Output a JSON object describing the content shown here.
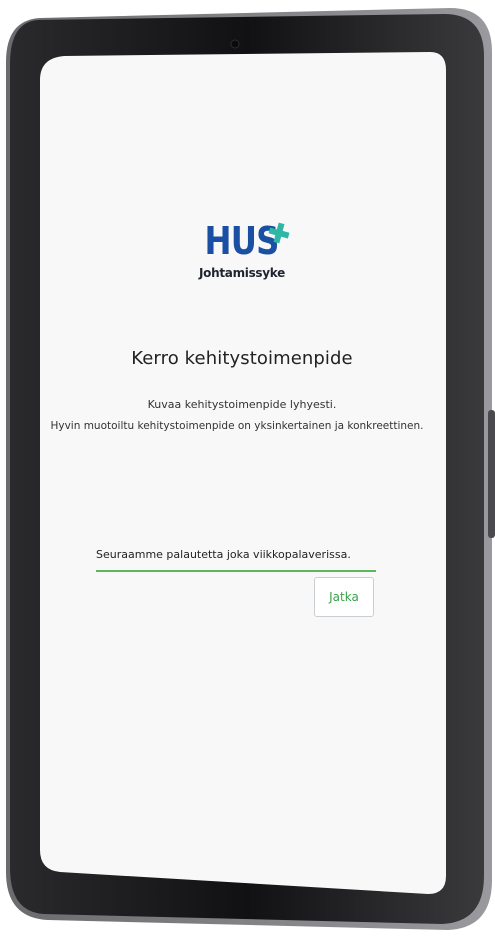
{
  "logo": {
    "brand": "HUS",
    "subtitle": "Johtamissyke",
    "brand_color": "#1a4fa3",
    "cross_color": "#2fb7a6"
  },
  "page": {
    "title": "Kerro kehitystoimenpide",
    "instruction": "Kuvaa kehitystoimenpide lyhyesti.",
    "hint": "Hyvin muotoiltu kehitystoimenpide on yksinkertainen ja konkreettinen."
  },
  "form": {
    "field_value": "Seuraamme palautetta joka viikkopalaverissa.",
    "accent_color": "#5db85c",
    "submit_label": "Jatka"
  }
}
